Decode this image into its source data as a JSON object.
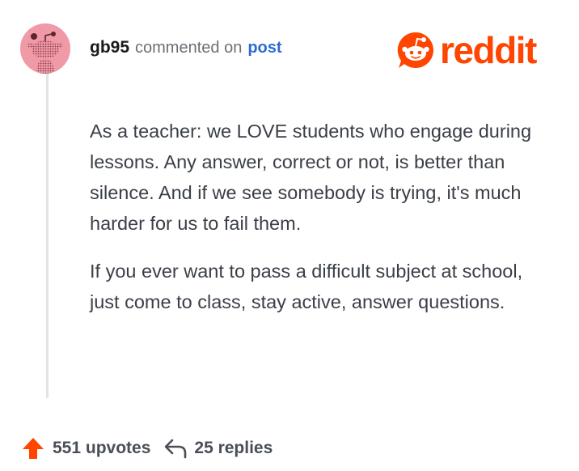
{
  "comment": {
    "username": "gb95",
    "action_text": "commented on",
    "post_link": "post",
    "paragraphs": [
      "As a teacher: we LOVE students who engage during lessons. Any answer, correct or not, is better than silence. And if we see somebody is trying, it's much harder for us to fail them.",
      "If you ever want to pass a difficult subject at school, just come to class, stay active, answer questions."
    ],
    "upvotes": "551 upvotes",
    "replies": "25 replies"
  },
  "brand": {
    "wordmark": "reddit",
    "color": "#ff4500"
  },
  "colors": {
    "avatar_bg": "#f09aa8",
    "link": "#2c6bd6",
    "upvote": "#ff4500",
    "thread_line": "#e3e3e3"
  },
  "icons": {
    "avatar": "snoo-avatar-icon",
    "logo": "reddit-snoo-icon",
    "upvote": "upvote-arrow-icon",
    "reply": "reply-arrow-icon"
  }
}
